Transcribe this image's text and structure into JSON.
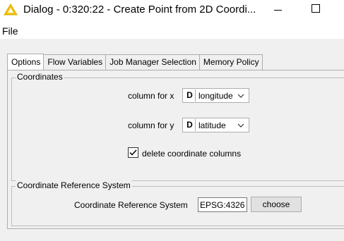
{
  "window": {
    "title": "Dialog - 0:320:22 - Create Point from 2D Coordi...",
    "icon": "knime-warning-triangle-icon",
    "controls": [
      "minimize-icon",
      "maximize-icon"
    ]
  },
  "menu": {
    "file_label": "File"
  },
  "tabs": [
    {
      "label": "Options",
      "active": true
    },
    {
      "label": "Flow Variables",
      "active": false
    },
    {
      "label": "Job Manager Selection",
      "active": false
    },
    {
      "label": "Memory Policy",
      "active": false
    }
  ],
  "coordinates": {
    "legend": "Coordinates",
    "x_label": "column for x",
    "x_type": "D",
    "x_value": "longitude",
    "y_label": "column for y",
    "y_type": "D",
    "y_value": "latitude",
    "delete_label": "delete coordinate columns",
    "delete_checked": true
  },
  "crs": {
    "legend": "Coordinate Reference System",
    "label": "Coordinate Reference System",
    "value": "EPSG:4326",
    "button_label": "choose"
  }
}
